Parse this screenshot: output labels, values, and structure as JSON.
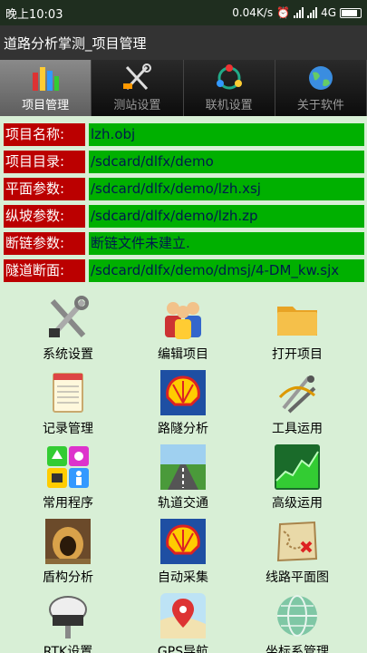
{
  "status": {
    "time": "晚上10:03",
    "speed": "0.04K/s",
    "network": "4G"
  },
  "app": {
    "title": "道路分析掌测_项目管理"
  },
  "tabs": [
    {
      "label": "项目管理",
      "icon": "bar-chart-icon",
      "active": true
    },
    {
      "label": "测站设置",
      "icon": "tools-icon",
      "active": false
    },
    {
      "label": "联机设置",
      "icon": "connect-icon",
      "active": false
    },
    {
      "label": "关于软件",
      "icon": "globe-icon",
      "active": false
    }
  ],
  "info": [
    {
      "label": "项目名称:",
      "value": "lzh.obj"
    },
    {
      "label": "项目目录:",
      "value": "/sdcard/dlfx/demo"
    },
    {
      "label": "平面参数:",
      "value": "/sdcard/dlfx/demo/lzh.xsj"
    },
    {
      "label": "纵坡参数:",
      "value": "/sdcard/dlfx/demo/lzh.zp"
    },
    {
      "label": "断链参数:",
      "value": "断链文件未建立."
    },
    {
      "label": "隧道断面:",
      "value": "/sdcard/dlfx/demo/dmsj/4-DM_kw.sjx"
    }
  ],
  "menu": [
    {
      "label": "系统设置",
      "icon": "system-settings-icon"
    },
    {
      "label": "编辑项目",
      "icon": "edit-project-icon"
    },
    {
      "label": "打开项目",
      "icon": "folder-icon"
    },
    {
      "label": "记录管理",
      "icon": "notepad-icon"
    },
    {
      "label": "路隧分析",
      "icon": "shell-logo-icon"
    },
    {
      "label": "工具运用",
      "icon": "compass-icon"
    },
    {
      "label": "常用程序",
      "icon": "apps-icon"
    },
    {
      "label": "轨道交通",
      "icon": "road-icon"
    },
    {
      "label": "高级运用",
      "icon": "stock-chart-icon"
    },
    {
      "label": "盾构分析",
      "icon": "tunnel-icon"
    },
    {
      "label": "自动采集",
      "icon": "shell-logo-icon"
    },
    {
      "label": "线路平面图",
      "icon": "treasure-map-icon"
    },
    {
      "label": "RTK设置",
      "icon": "rtk-receiver-icon"
    },
    {
      "label": "GPS导航",
      "icon": "gps-map-icon"
    },
    {
      "label": "坐标系管理",
      "icon": "globe-icon"
    }
  ]
}
